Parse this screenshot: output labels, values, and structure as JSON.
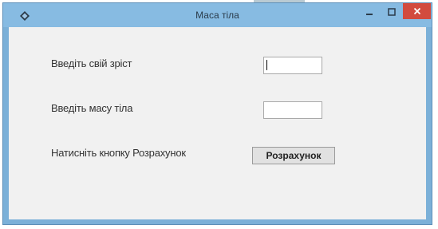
{
  "window": {
    "title": "Маса тіла",
    "colors": {
      "frame": "#7bb0d8",
      "close_button": "#d24b3e",
      "client": "#f1f1f1"
    }
  },
  "form": {
    "height_label": "Введіть свій зріст",
    "height_value": "",
    "mass_label": "Введіть масу тіла",
    "mass_value": "",
    "button_hint": "Натисніть кнопку Розрахунок",
    "button_label": "Розрахунок"
  },
  "icons": {
    "app": "app-icon",
    "minimize": "minimize-icon",
    "maximize": "maximize-icon",
    "close": "close-icon"
  }
}
